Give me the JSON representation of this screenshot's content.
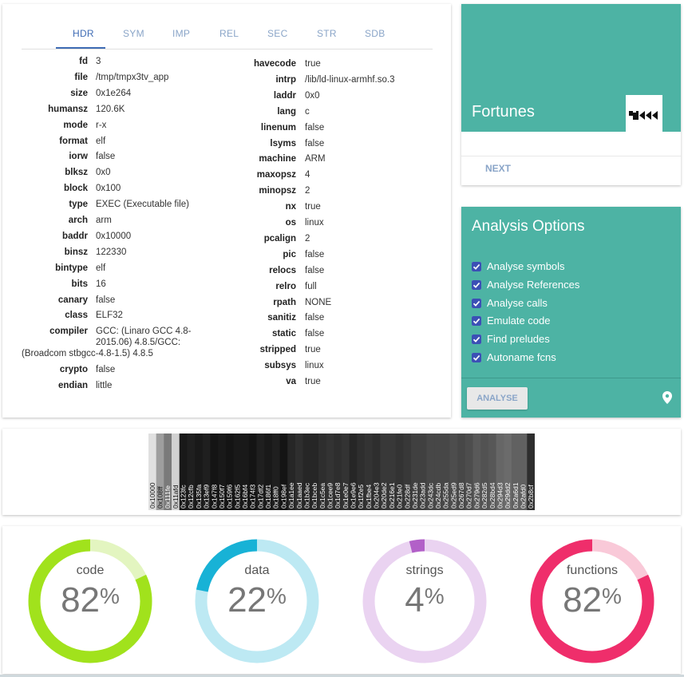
{
  "tabs": [
    "HDR",
    "SYM",
    "IMP",
    "REL",
    "SEC",
    "STR",
    "SDB"
  ],
  "active_tab": "HDR",
  "header_left": [
    {
      "k": "fd",
      "v": "3"
    },
    {
      "k": "file",
      "v": "/tmp/tmpx3tv_app"
    },
    {
      "k": "size",
      "v": "0x1e264"
    },
    {
      "k": "humansz",
      "v": "120.6K"
    },
    {
      "k": "mode",
      "v": "r-x"
    },
    {
      "k": "format",
      "v": "elf"
    },
    {
      "k": "iorw",
      "v": "false"
    },
    {
      "k": "blksz",
      "v": "0x0"
    },
    {
      "k": "block",
      "v": "0x100"
    },
    {
      "k": "type",
      "v": "EXEC (Executable file)"
    },
    {
      "k": "arch",
      "v": "arm"
    },
    {
      "k": "baddr",
      "v": "0x10000"
    },
    {
      "k": "binsz",
      "v": "122330"
    },
    {
      "k": "bintype",
      "v": "elf"
    },
    {
      "k": "bits",
      "v": "16"
    },
    {
      "k": "canary",
      "v": "false"
    },
    {
      "k": "class",
      "v": "ELF32"
    },
    {
      "k": "compiler",
      "v": "GCC: (Linaro GCC 4.8-",
      "v2": "2015.06) 4.8.5/GCC:",
      "v3": "(Broadcom stbgcc-4.8-1.5) 4.8.5"
    },
    {
      "k": "crypto",
      "v": "false"
    },
    {
      "k": "endian",
      "v": "little"
    }
  ],
  "header_right": [
    {
      "k": "havecode",
      "v": "true"
    },
    {
      "k": "intrp",
      "v": "/lib/ld-linux-armhf.so.3"
    },
    {
      "k": "laddr",
      "v": "0x0"
    },
    {
      "k": "lang",
      "v": "c"
    },
    {
      "k": "linenum",
      "v": "false"
    },
    {
      "k": "lsyms",
      "v": "false"
    },
    {
      "k": "machine",
      "v": "ARM"
    },
    {
      "k": "maxopsz",
      "v": "4"
    },
    {
      "k": "minopsz",
      "v": "2"
    },
    {
      "k": "nx",
      "v": "true"
    },
    {
      "k": "os",
      "v": "linux"
    },
    {
      "k": "pcalign",
      "v": "2"
    },
    {
      "k": "pic",
      "v": "false"
    },
    {
      "k": "relocs",
      "v": "false"
    },
    {
      "k": "relro",
      "v": "full"
    },
    {
      "k": "rpath",
      "v": "NONE"
    },
    {
      "k": "sanitiz",
      "v": "false"
    },
    {
      "k": "static",
      "v": "false"
    },
    {
      "k": "stripped",
      "v": "true"
    },
    {
      "k": "subsys",
      "v": "linux"
    },
    {
      "k": "va",
      "v": "true"
    }
  ],
  "fortunes": {
    "title": "Fortunes",
    "next_label": "NEXT"
  },
  "analysis": {
    "title": "Analysis Options",
    "options": [
      {
        "label": "Analyse symbols",
        "checked": true
      },
      {
        "label": "Analyse References",
        "checked": true
      },
      {
        "label": "Analyse calls",
        "checked": true
      },
      {
        "label": "Emulate code",
        "checked": true
      },
      {
        "label": "Find preludes",
        "checked": true
      },
      {
        "label": "Autoname fcns",
        "checked": true
      }
    ],
    "analyse_label": "ANALYSE"
  },
  "entropy": {
    "blocks": [
      "0x10000",
      "0x108ff",
      "0x111fe",
      "0x11afd",
      "0x123fc",
      "0x12cfb",
      "0x135fa",
      "0x13ef9",
      "0x147f8",
      "0x150f7",
      "0x159f6",
      "0x162f5",
      "0x16bf4",
      "0x174f3",
      "0x17df2",
      "0x186f1",
      "0x18ff0",
      "0x198ef",
      "0x1a1ee",
      "0x1aaed",
      "0x1b3ec",
      "0x1bceb",
      "0x1c5ea",
      "0x1cee9",
      "0x1d7e8",
      "0x1e0e7",
      "0x1e9e6",
      "0x1f2e5",
      "0x1fbe4",
      "0x204e3",
      "0x20de2",
      "0x216e1",
      "0x21fe0",
      "0x228df",
      "0x231de",
      "0x23add",
      "0x243dc",
      "0x24cdb",
      "0x255da",
      "0x25ed9",
      "0x267d8",
      "0x270d7",
      "0x279d6",
      "0x282d5",
      "0x28bd4",
      "0x294d3",
      "0x29dd2",
      "0x2a6d1",
      "0x2afd0",
      "0x2b8cf"
    ],
    "levels": [
      0.12,
      0.38,
      0.52,
      0.18,
      0.9,
      0.88,
      0.9,
      0.88,
      0.92,
      0.9,
      0.92,
      0.9,
      0.9,
      0.92,
      0.88,
      0.9,
      0.88,
      0.92,
      0.85,
      0.82,
      0.85,
      0.85,
      0.82,
      0.8,
      0.82,
      0.8,
      0.85,
      0.82,
      0.8,
      0.82,
      0.78,
      0.78,
      0.8,
      0.78,
      0.75,
      0.75,
      0.72,
      0.72,
      0.72,
      0.7,
      0.72,
      0.7,
      0.65,
      0.68,
      0.66,
      0.6,
      0.58,
      0.62,
      0.62,
      0.82
    ]
  },
  "stats": [
    {
      "label": "code",
      "value": 82,
      "color": "#a1e21c",
      "track": "#e3f5c0"
    },
    {
      "label": "data",
      "value": 22,
      "color": "#18b2d6",
      "track": "#bde9f3"
    },
    {
      "label": "strings",
      "value": 4,
      "color": "#b260c8",
      "track": "#ead3f1"
    },
    {
      "label": "functions",
      "value": 82,
      "color": "#ef2e6b",
      "track": "#f9c9d8"
    }
  ],
  "pct_symbol": "%",
  "colors": {
    "teal": "#4db3a4",
    "tab_text": "#8aa5c8",
    "tab_active": "#3f6cb5"
  }
}
